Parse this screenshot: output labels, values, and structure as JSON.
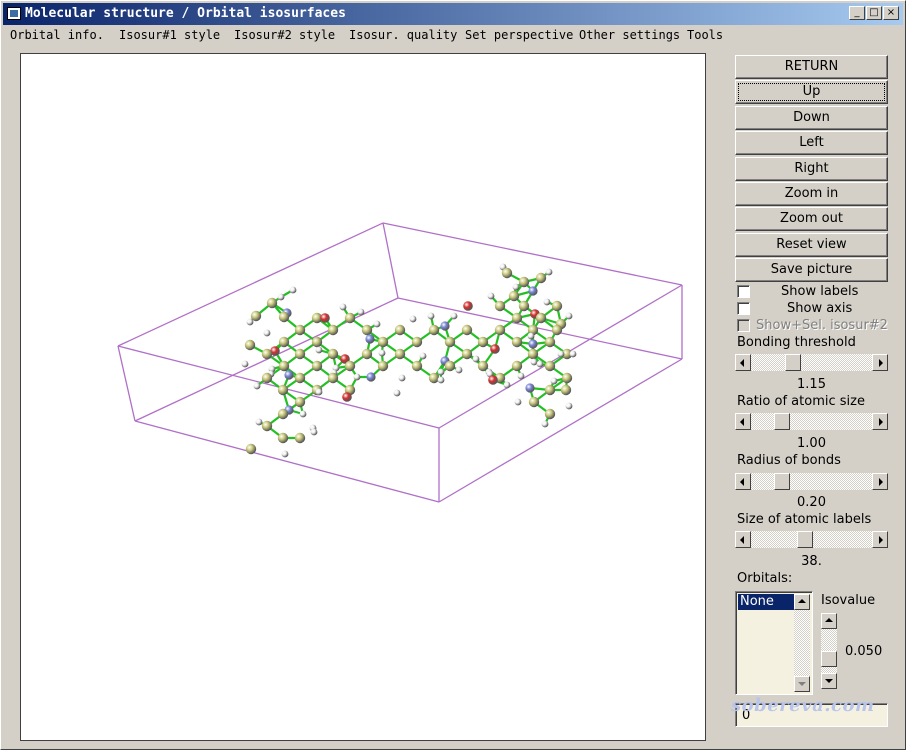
{
  "window": {
    "title": "Molecular structure / Orbital isosurfaces",
    "minimize": "_",
    "maximize": "□",
    "close": "×"
  },
  "menu": [
    "Orbital info.",
    "Isosur#1 style",
    "Isosur#2 style",
    "Isosur. quality",
    "Set perspective",
    "Other settings",
    "Tools"
  ],
  "buttons": {
    "return": "RETURN",
    "up": "Up",
    "down": "Down",
    "left": "Left",
    "right": "Right",
    "zoom_in": "Zoom in",
    "zoom_out": "Zoom out",
    "reset_view": "Reset view",
    "save_picture": "Save picture"
  },
  "checkboxes": {
    "show_labels": "Show labels",
    "show_axis": "Show axis",
    "show_sel_isosur2": "Show+Sel. isosur#2"
  },
  "sliders": {
    "bonding_threshold": {
      "label": "Bonding threshold",
      "value": "1.15",
      "fraction": 0.32
    },
    "ratio_atomic_size": {
      "label": "Ratio of atomic size",
      "value": "1.00",
      "fraction": 0.22
    },
    "radius_bonds": {
      "label": "Radius of bonds",
      "value": "0.20",
      "fraction": 0.22
    },
    "size_atomic_labels": {
      "label": "Size of atomic labels",
      "value": "38.",
      "fraction": 0.44
    }
  },
  "orbitals": {
    "label": "Orbitals:",
    "selected": "None"
  },
  "isovalue": {
    "label": "Isovalue",
    "value": "0.050"
  },
  "text_input": "0",
  "watermark": "sobereva.com",
  "colors": {
    "carbon": "#c8c87a",
    "hydrogen": "#f0f0f0",
    "nitrogen": "#7a86d8",
    "oxygen": "#d83030",
    "bond": "#22c022",
    "box": "#b070c8"
  }
}
